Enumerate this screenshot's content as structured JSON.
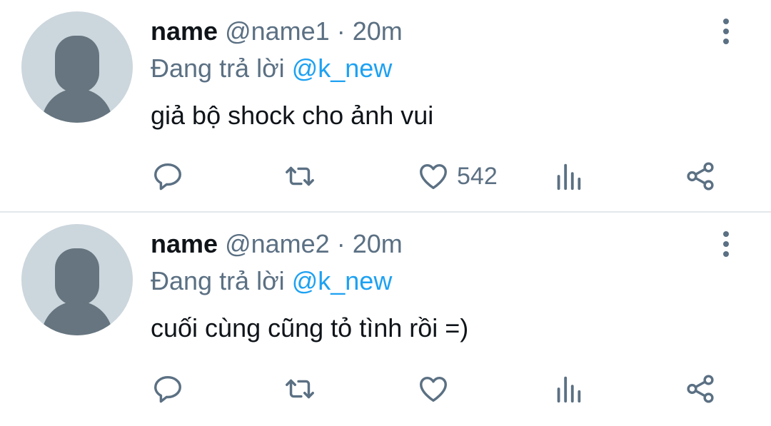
{
  "tweets": [
    {
      "display_name": "name",
      "handle": "@name1",
      "separator": "·",
      "time": "20m",
      "reply_prefix": "Đang trả lời",
      "reply_to": "@k_new",
      "text": "giả bộ shock cho ảnh vui",
      "likes": "542",
      "icons": {
        "more": "more-vertical-icon",
        "reply": "reply-icon",
        "retweet": "retweet-icon",
        "like": "heart-icon",
        "stats": "analytics-icon",
        "share": "share-icon"
      }
    },
    {
      "display_name": "name",
      "handle": "@name2",
      "separator": "·",
      "time": "20m",
      "reply_prefix": "Đang trả lời",
      "reply_to": "@k_new",
      "text": "cuối cùng cũng tỏ tình rồi =)",
      "likes": "",
      "icons": {
        "more": "more-vertical-icon",
        "reply": "reply-icon",
        "retweet": "retweet-icon",
        "like": "heart-icon",
        "stats": "analytics-icon",
        "share": "share-icon"
      }
    }
  ],
  "colors": {
    "text_primary": "#0f1419",
    "text_secondary": "#5b7083",
    "accent": "#1da1f2",
    "avatar_bg": "#ccd6dd",
    "avatar_fg": "#66757f",
    "divider": "#e4e7ea"
  }
}
